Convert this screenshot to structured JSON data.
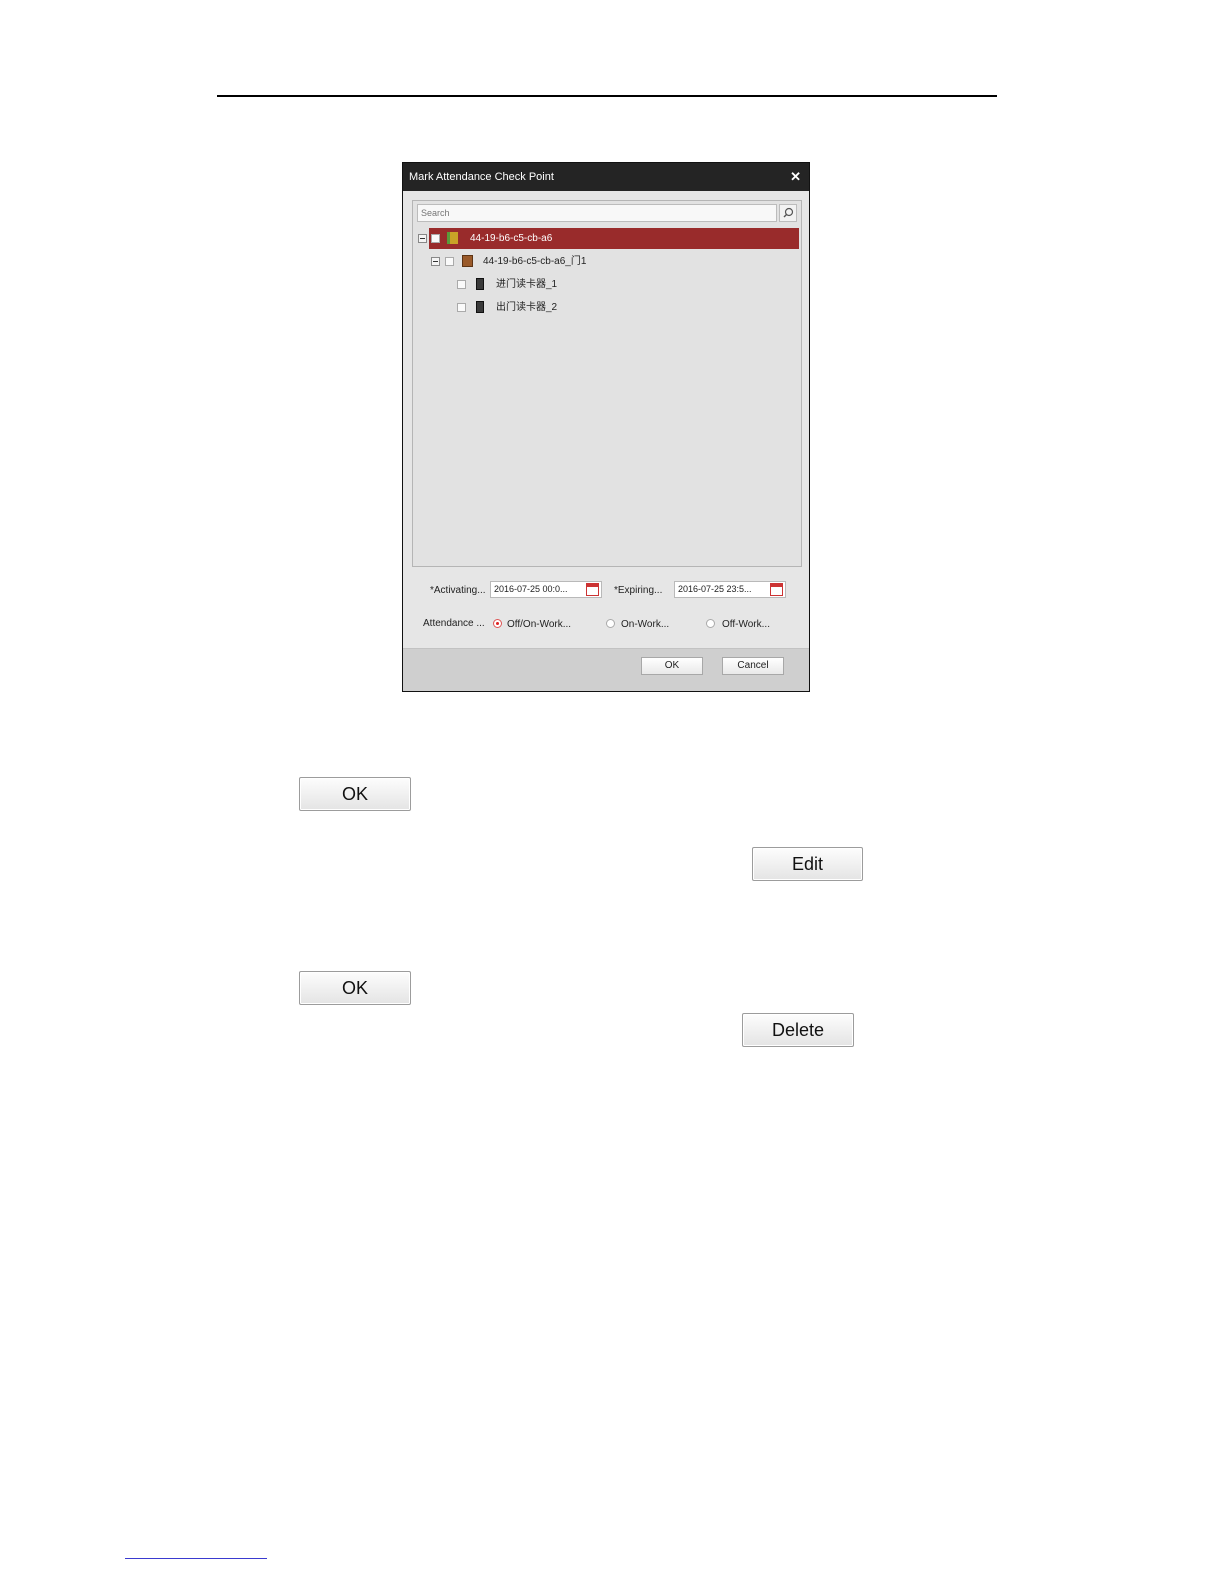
{
  "dialog": {
    "title": "Mark Attendance Check Point",
    "search_placeholder": "Search",
    "tree": [
      {
        "label": "44-19-b6-c5-cb-a6",
        "type": "device",
        "selected": true
      },
      {
        "label": "44-19-b6-c5-cb-a6_门1",
        "type": "door",
        "selected": false
      },
      {
        "label": "进门读卡器_1",
        "type": "reader",
        "selected": false
      },
      {
        "label": "出门读卡器_2",
        "type": "reader",
        "selected": false
      }
    ],
    "activating_label": "*Activating...",
    "activating_value": "2016-07-25 00:0...",
    "expiring_label": "*Expiring...",
    "expiring_value": "2016-07-25 23:5...",
    "attendance_label": "Attendance ...",
    "attendance_options": [
      "Off/On-Work...",
      "On-Work...",
      "Off-Work..."
    ],
    "attendance_selected": "Off/On-Work...",
    "ok_label": "OK",
    "cancel_label": "Cancel"
  },
  "buttons": {
    "ok_1": "OK",
    "edit": "Edit",
    "ok_2": "OK",
    "delete": "Delete"
  }
}
